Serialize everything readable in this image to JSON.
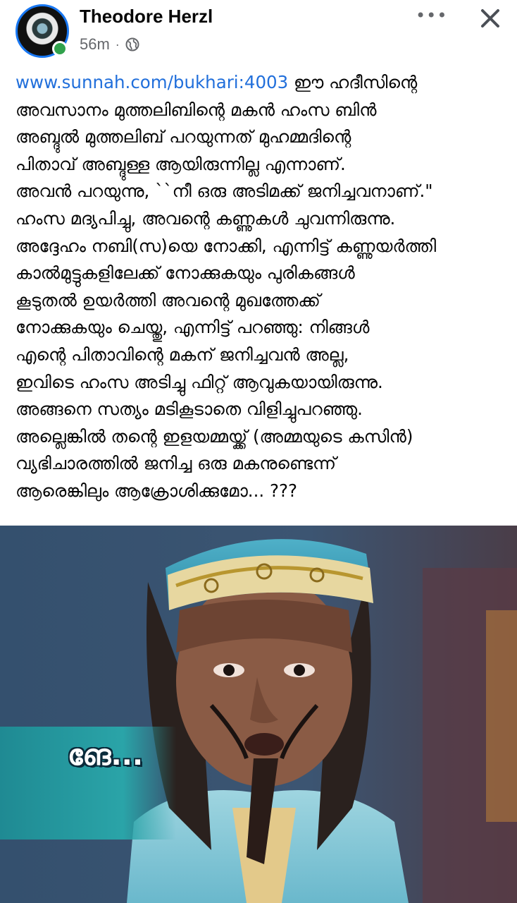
{
  "post": {
    "author": "Theodore Herzl",
    "time": "56m",
    "separator": "·",
    "more_label": "•••",
    "link_text": "www.sunnah.com/bukhari:4003",
    "body_text": " ഈ ഹദീസിന്റെ\nഅവസാനം മുത്തലിബിന്റെ മകൻ ഹംസ ബിൻ\nഅബ്ദുൽ മുത്തലിബ് പറയുന്നത് മുഹമ്മദിന്റെ\nപിതാവ് അബ്ദുള്ള ആയിരുന്നില്ല എന്നാണ്.\nഅവൻ പറയുന്നു, ``നീ ഒരു അടിമക്ക് ജനിച്ചവനാണ്.\"\nഹംസ മദ്യപിച്ചു, അവന്റെ കണ്ണുകൾ ചുവന്നിരുന്നു.\nഅദ്ദേഹം നബി(സ)യെ നോക്കി, എന്നിട്ട് കണ്ണുയർത്തി\nകാൽമുട്ടുകളിലേക്ക് നോക്കുകയും പുരികങ്ങൾ\nകൂടുതൽ ഉയർത്തി അവന്റെ മുഖത്തേക്ക്\nനോക്കുകയും ചെയ്തു, എന്നിട്ട് പറഞ്ഞു: നിങ്ങൾ\nഎന്റെ പിതാവിന്റെ മകന് ജനിച്ചവൻ അല്ല,\nഇവിടെ ഹംസ അടിച്ചു ഫിറ്റ് ആവുകയായിരുന്നു.\nഅങ്ങനെ സത്യം മടികൂടാതെ വിളിച്ചുപറഞ്ഞു.\nഅല്ലെങ്കിൽ തന്റെ ഇളയമ്മയ്ക്ക് (അമ്മയുടെ കസിൻ)\nവ്യഭിചാരത്തിൽ ജനിച്ച ഒരു മകനുണ്ടെന്ന്\nആരെങ്കിലും ആക്രോശിക്കുമോ... ???",
    "image_caption": "ങേ..."
  },
  "icons": {
    "avatar": "avatar",
    "online": "online-status-dot",
    "audience": "globe-icon",
    "more": "more-options-icon",
    "close": "close-icon"
  },
  "colors": {
    "link": "#216fdb",
    "online": "#31a24c",
    "avatar_ring": "#1877f2",
    "meta": "#65676b"
  }
}
